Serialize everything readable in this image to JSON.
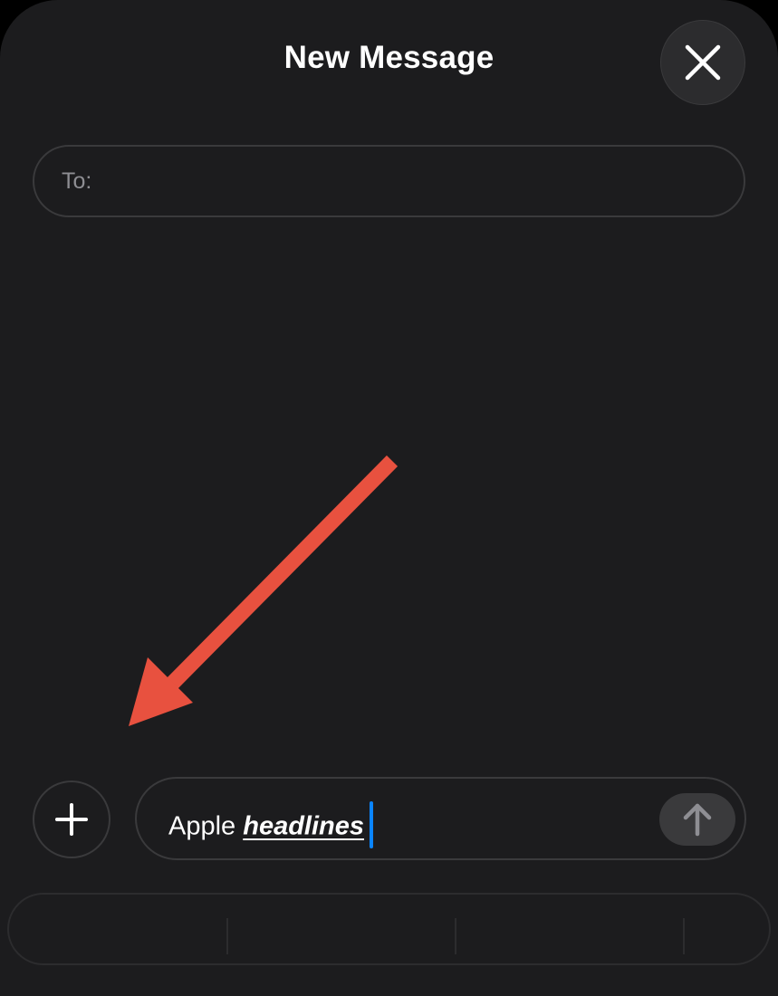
{
  "header": {
    "title": "New Message",
    "close_icon": "close-icon"
  },
  "recipient": {
    "label": "To:",
    "value": ""
  },
  "composer": {
    "plus_icon": "plus-icon",
    "text_plain": "Apple ",
    "text_emphasis": "headlines",
    "send_icon": "arrow-up-icon",
    "caret_color": "#0a84ff"
  },
  "annotation": {
    "arrow_icon": "red-arrow-icon",
    "color": "#e8513f"
  },
  "colors": {
    "background": "#1c1c1e",
    "border": "#3a3a3c",
    "text": "#ffffff",
    "muted": "#8e8e93"
  }
}
